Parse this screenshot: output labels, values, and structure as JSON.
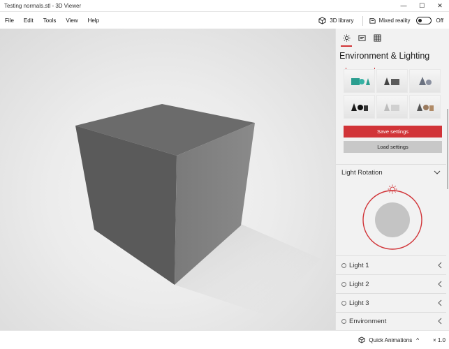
{
  "window": {
    "title": "Testing normals.stl - 3D Viewer",
    "controls": {
      "minimize": "—",
      "maximize": "☐",
      "close": "✕"
    }
  },
  "menu": {
    "items": [
      "File",
      "Edit",
      "Tools",
      "View",
      "Help"
    ],
    "library_label": "3D library",
    "mixed_reality_label": "Mixed reality",
    "toggle_state": "Off"
  },
  "viewport": {
    "object": "cube",
    "colors": {
      "top": "#6a6a6a",
      "left": "#5a5a5a",
      "right": "#808080"
    }
  },
  "panel": {
    "tab_icons": [
      "sun-icon",
      "stats-icon",
      "grid-icon"
    ],
    "active_tab": 0,
    "title": "Environment & Lighting",
    "thumbnails": [
      {
        "name": "preset-teal-shapes",
        "color": "#2a9d8f"
      },
      {
        "name": "preset-dark-gray-shapes",
        "color": "#555555"
      },
      {
        "name": "preset-blue-gray-shapes",
        "color": "#6b7280"
      },
      {
        "name": "preset-black-shapes",
        "color": "#1a1a1a"
      },
      {
        "name": "preset-light-gray-shapes",
        "color": "#c8c8c8"
      },
      {
        "name": "preset-bronze-shapes",
        "color": "#9a7b5f"
      }
    ],
    "save_label": "Save settings",
    "load_label": "Load settings",
    "light_rotation_label": "Light Rotation",
    "lights": [
      "Light 1",
      "Light 2",
      "Light 3",
      "Environment"
    ],
    "accent": "#d13438"
  },
  "status": {
    "quick_animations_label": "Quick Animations",
    "caret": "^",
    "speed": "× 1.0"
  }
}
